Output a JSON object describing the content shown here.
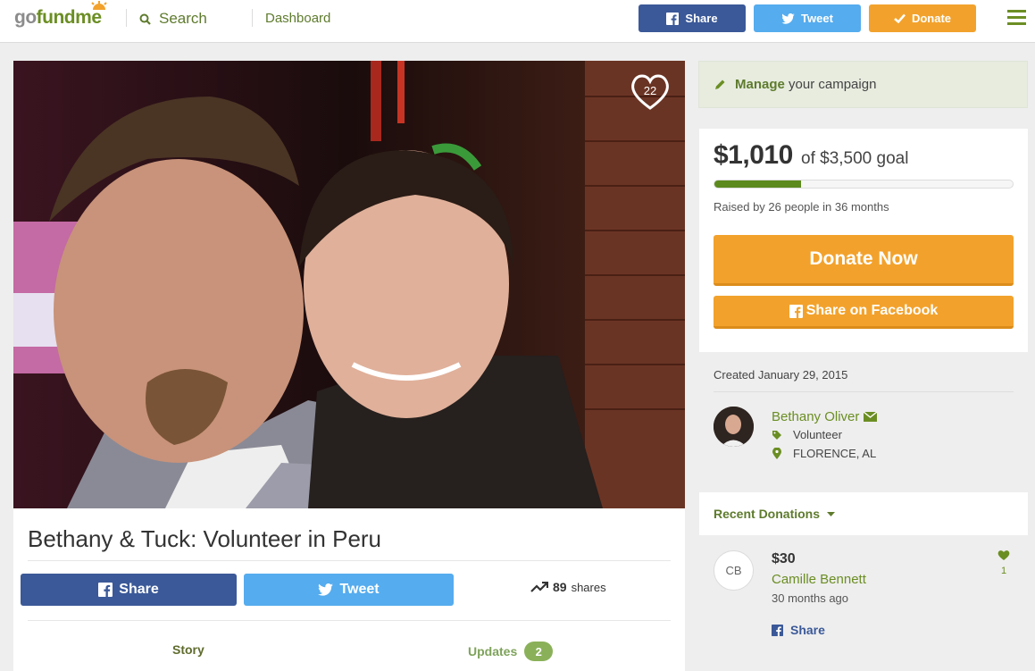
{
  "header": {
    "logo": {
      "go": "go",
      "fund": "fund",
      "me": "me"
    },
    "search_label": "Search",
    "dashboard_label": "Dashboard",
    "share_label": "Share",
    "tweet_label": "Tweet",
    "donate_label": "Donate"
  },
  "photo": {
    "heart_count": "22"
  },
  "campaign": {
    "title": "Bethany & Tuck: Volunteer in Peru",
    "share_label": "Share",
    "tweet_label": "Tweet",
    "shares_count": "89",
    "shares_label": "shares",
    "tabs": {
      "story": "Story",
      "updates": "Updates",
      "updates_count": "2"
    }
  },
  "sidebar": {
    "manage_bold": "Manage",
    "manage_rest": "your campaign",
    "raised": "$1,010",
    "goal_text": "of $3,500 goal",
    "progress_fraction": 0.29,
    "raised_by": "Raised by 26 people in 36 months",
    "donate_now": "Donate Now",
    "share_facebook": "Share on Facebook",
    "created": "Created January 29, 2015",
    "organizer": {
      "name": "Bethany Oliver",
      "category": "Volunteer",
      "location": "FLORENCE, AL"
    },
    "recent_donations_label": "Recent Donations",
    "donations": [
      {
        "initials": "CB",
        "amount": "$30",
        "name": "Camille Bennett",
        "time": "30 months ago",
        "share_label": "Share",
        "likes": "1"
      }
    ]
  },
  "colors": {
    "brand_green": "#6b8e23",
    "facebook": "#3b5998",
    "twitter": "#55acee",
    "donate_orange": "#f2a22c"
  }
}
